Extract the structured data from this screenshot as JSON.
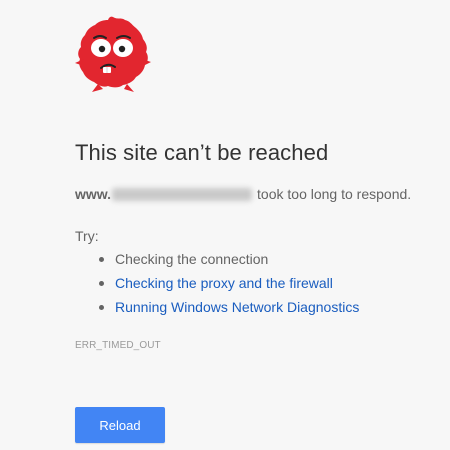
{
  "monster": {
    "icon": "red-fuzzy-monster-icon",
    "color": "#e2262f"
  },
  "error": {
    "title": "This site can’t be reached",
    "domain_prefix": "www.",
    "domain_obscured": true,
    "message": "took too long to respond."
  },
  "suggestions": {
    "label": "Try:",
    "items": [
      {
        "text": "Checking the connection",
        "link": false
      },
      {
        "text": "Checking the proxy and the firewall",
        "link": true
      },
      {
        "text": "Running Windows Network Diagnostics",
        "link": true
      }
    ]
  },
  "error_code": "ERR_TIMED_OUT",
  "reload": {
    "label": "Reload",
    "color": "#4285f4"
  },
  "colors": {
    "background": "#f7f7f7",
    "heading": "#333333",
    "body_text": "#646464",
    "link": "#1a5dbf",
    "code": "#9a9a9a"
  }
}
